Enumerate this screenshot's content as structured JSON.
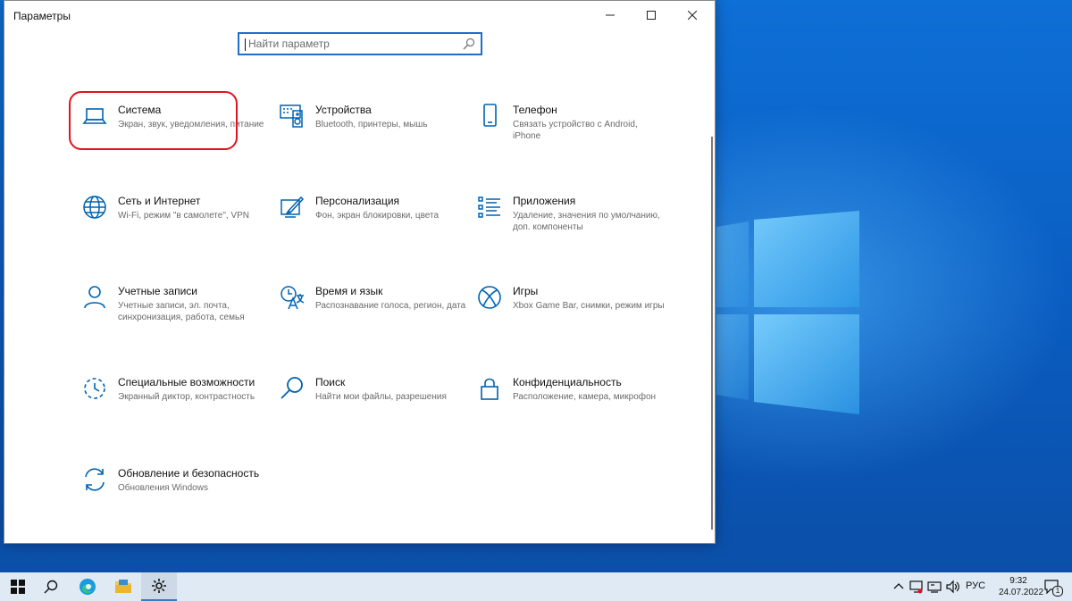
{
  "window": {
    "title": "Параметры",
    "search_placeholder": "Найти параметр"
  },
  "tiles": [
    {
      "name": "Система",
      "desc": "Экран, звук, уведомления, питание",
      "icon": "laptop-icon"
    },
    {
      "name": "Устройства",
      "desc": "Bluetooth, принтеры, мышь",
      "icon": "devices-icon"
    },
    {
      "name": "Телефон",
      "desc": "Связать устройство с Android, iPhone",
      "icon": "phone-icon"
    },
    {
      "name": "Сеть и Интернет",
      "desc": "Wi-Fi, режим \"в самолете\", VPN",
      "icon": "globe-icon"
    },
    {
      "name": "Персонализация",
      "desc": "Фон, экран блокировки, цвета",
      "icon": "personalization-icon"
    },
    {
      "name": "Приложения",
      "desc": "Удаление, значения по умолчанию, доп. компоненты",
      "icon": "apps-list-icon"
    },
    {
      "name": "Учетные записи",
      "desc": "Учетные записи, эл. почта, синхронизация, работа, семья",
      "icon": "person-icon"
    },
    {
      "name": "Время и язык",
      "desc": "Распознавание голоса, регион, дата",
      "icon": "time-language-icon"
    },
    {
      "name": "Игры",
      "desc": "Xbox Game Bar, снимки, режим игры",
      "icon": "xbox-icon"
    },
    {
      "name": "Специальные возможности",
      "desc": "Экранный диктор, контрастность",
      "icon": "accessibility-icon"
    },
    {
      "name": "Поиск",
      "desc": "Найти мои файлы, разрешения",
      "icon": "search-icon"
    },
    {
      "name": "Конфиденциальность",
      "desc": "Расположение, камера, микрофон",
      "icon": "lock-icon"
    },
    {
      "name": "Обновление и безопасность",
      "desc": "Обновления Windows",
      "icon": "update-icon"
    }
  ],
  "taskbar": {
    "language": "РУС",
    "time": "9:32",
    "date": "24.07.2022",
    "notification_count": "1"
  },
  "colors": {
    "accent": "#0063b1",
    "highlight": "#e0141e"
  }
}
